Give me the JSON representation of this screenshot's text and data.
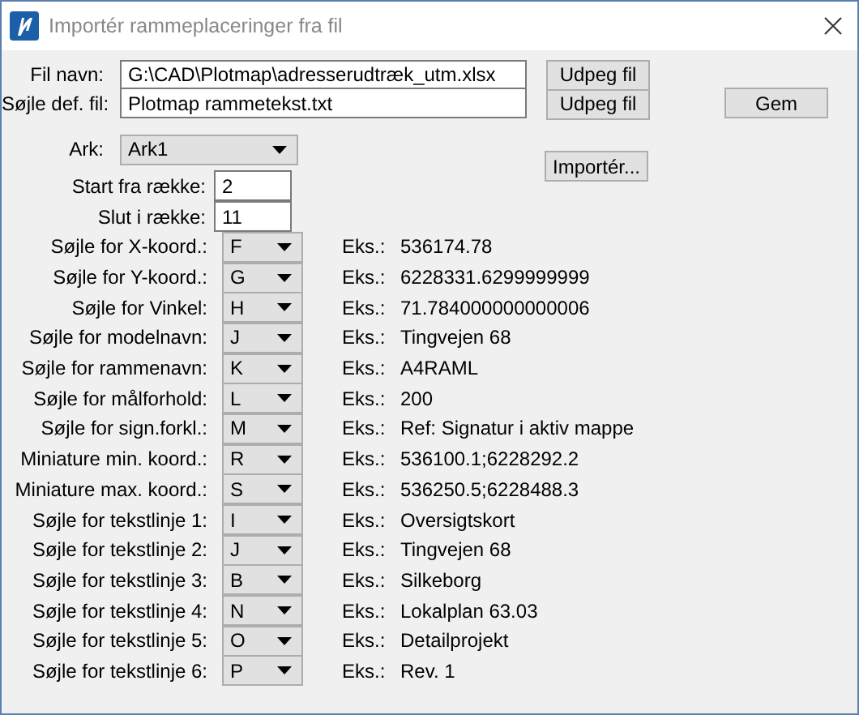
{
  "window": {
    "title": "Importér rammeplaceringer fra fil"
  },
  "file_fields": [
    {
      "label": "Fil navn:",
      "value": "G:\\CAD\\Plotmap\\adresserudtræk_utm.xlsx",
      "button": "Udpeg fil"
    },
    {
      "label": "Søjle def. fil:",
      "value": "Plotmap rammetekst.txt",
      "button": "Udpeg fil"
    }
  ],
  "save_button": "Gem",
  "sheet": {
    "label": "Ark:",
    "value": "Ark1"
  },
  "start_row": {
    "label": "Start fra række:",
    "value": "2"
  },
  "end_row": {
    "label": "Slut i række:",
    "value": "11"
  },
  "import_button": "Importér...",
  "columns": [
    {
      "label": "Søjle for X-koord.:",
      "value": "F",
      "example_label": "Eks.:",
      "example": "536174.78"
    },
    {
      "label": "Søjle for Y-koord.:",
      "value": "G",
      "example_label": "Eks.:",
      "example": "6228331.6299999999"
    },
    {
      "label": "Søjle for Vinkel:",
      "value": "H",
      "example_label": "Eks.:",
      "example": "71.784000000000006"
    },
    {
      "label": "Søjle for modelnavn:",
      "value": "J",
      "example_label": "Eks.:",
      "example": "Tingvejen 68"
    },
    {
      "label": "Søjle for rammenavn:",
      "value": "K",
      "example_label": "Eks.:",
      "example": "A4RAML"
    },
    {
      "label": "Søjle for målforhold:",
      "value": "L",
      "example_label": "Eks.:",
      "example": "200"
    },
    {
      "label": "Søjle for sign.forkl.:",
      "value": "M",
      "example_label": "Eks.:",
      "example": "Ref: Signatur i aktiv mappe"
    },
    {
      "label": "Miniature min. koord.:",
      "value": "R",
      "example_label": "Eks.:",
      "example": "536100.1;6228292.2"
    },
    {
      "label": "Miniature max. koord.:",
      "value": "S",
      "example_label": "Eks.:",
      "example": "536250.5;6228488.3"
    },
    {
      "label": "Søjle for tekstlinje 1:",
      "value": "I",
      "example_label": "Eks.:",
      "example": "Oversigtskort"
    },
    {
      "label": "Søjle for tekstlinje 2:",
      "value": "J",
      "example_label": "Eks.:",
      "example": "Tingvejen 68"
    },
    {
      "label": "Søjle for tekstlinje 3:",
      "value": "B",
      "example_label": "Eks.:",
      "example": "Silkeborg"
    },
    {
      "label": "Søjle for tekstlinje 4:",
      "value": "N",
      "example_label": "Eks.:",
      "example": "Lokalplan 63.03"
    },
    {
      "label": "Søjle for tekstlinje 5:",
      "value": "O",
      "example_label": "Eks.:",
      "example": "Detailprojekt"
    },
    {
      "label": "Søjle for tekstlinje 6:",
      "value": "P",
      "example_label": "Eks.:",
      "example": "Rev. 1"
    }
  ]
}
